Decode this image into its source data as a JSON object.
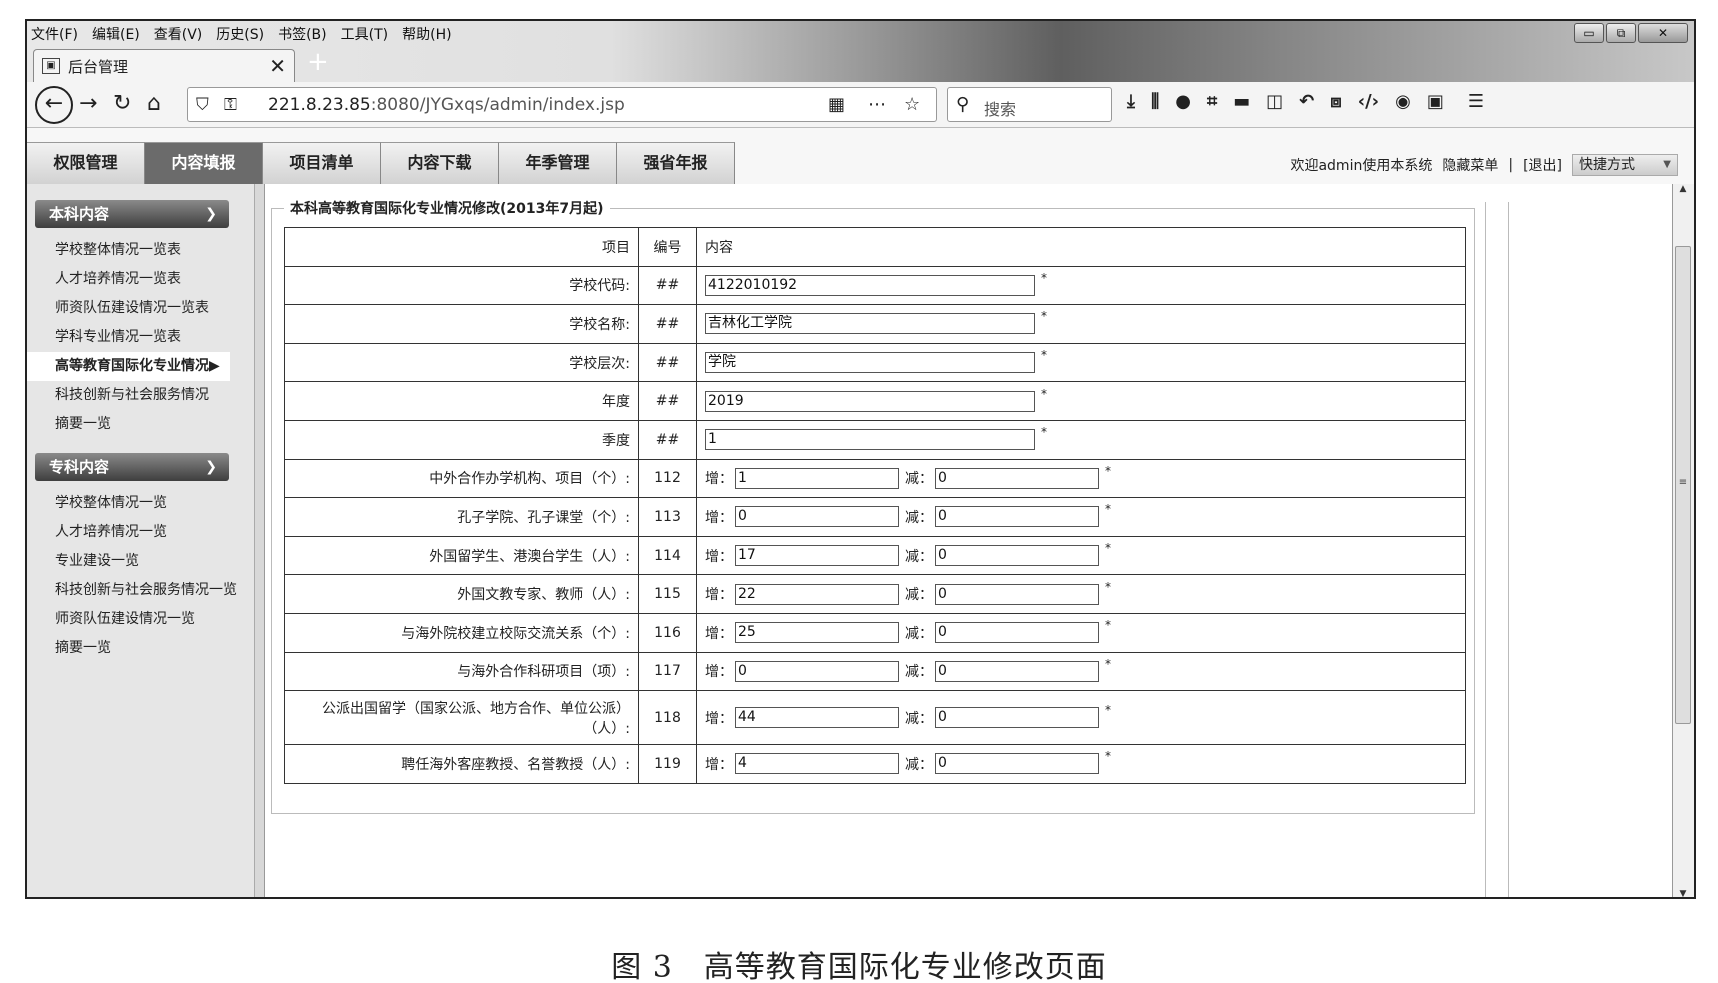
{
  "browser": {
    "menu": [
      "文件(F)",
      "编辑(E)",
      "查看(V)",
      "历史(S)",
      "书签(B)",
      "工具(T)",
      "帮助(H)"
    ],
    "tab_title": "后台管理",
    "tab_close": "✕",
    "new_tab": "+",
    "url_host": "221.8.23.85",
    "url_rest": ":8080/JYGxqs/admin/index.jsp",
    "search_placeholder": "搜索",
    "win_min": "▭",
    "win_max": "⧉",
    "win_close": "✕"
  },
  "app": {
    "tabs": [
      "权限管理",
      "内容填报",
      "项目清单",
      "内容下载",
      "年季管理",
      "强省年报"
    ],
    "active_tab": 1,
    "welcome": "欢迎admin使用本系统",
    "hide_menu": "隐藏菜单",
    "separator": "|",
    "logout": "[退出]",
    "quick": "快捷方式"
  },
  "sidebar": {
    "undergrad_title": "本科内容",
    "undergrad_items": [
      "学校整体情况一览表",
      "人才培养情况一览表",
      "师资队伍建设情况一览表",
      "学科专业情况一览表",
      "高等教育国际化专业情况▶",
      "科技创新与社会服务情况",
      "摘要一览"
    ],
    "vocational_title": "专科内容",
    "vocational_items": [
      "学校整体情况一览",
      "人才培养情况一览",
      "专业建设一览",
      "科技创新与社会服务情况一览",
      "师资队伍建设情况一览",
      "摘要一览"
    ]
  },
  "form": {
    "legend": "本科高等教育国际化专业情况修改(2013年7月起)",
    "headers": {
      "item": "项目",
      "no": "编号",
      "content": "内容"
    },
    "inc_label": "增：",
    "dec_label": "减：",
    "required": "*",
    "basic_rows": [
      {
        "label": "学校代码:",
        "no": "##",
        "value": "4122010192"
      },
      {
        "label": "学校名称:",
        "no": "##",
        "value": "吉林化工学院"
      },
      {
        "label": "学校层次:",
        "no": "##",
        "value": "学院"
      },
      {
        "label": "年度",
        "no": "##",
        "value": "2019"
      },
      {
        "label": "季度",
        "no": "##",
        "value": "1"
      }
    ],
    "delta_rows": [
      {
        "label": "中外合作办学机构、项目（个）:",
        "no": "112",
        "inc": "1",
        "dec": "0"
      },
      {
        "label": "孔子学院、孔子课堂（个）:",
        "no": "113",
        "inc": "0",
        "dec": "0"
      },
      {
        "label": "外国留学生、港澳台学生（人）:",
        "no": "114",
        "inc": "17",
        "dec": "0"
      },
      {
        "label": "外国文教专家、教师（人）:",
        "no": "115",
        "inc": "22",
        "dec": "0"
      },
      {
        "label": "与海外院校建立校际交流关系（个）:",
        "no": "116",
        "inc": "25",
        "dec": "0"
      },
      {
        "label": "与海外合作科研项目（项）:",
        "no": "117",
        "inc": "0",
        "dec": "0"
      },
      {
        "label_line1": "公派出国留学（国家公派、地方合作、单位公派）",
        "label_line2": "（人）:",
        "no": "118",
        "inc": "44",
        "dec": "0"
      },
      {
        "label": "聘任海外客座教授、名誉教授（人）:",
        "no": "119",
        "inc": "4",
        "dec": "0"
      }
    ]
  },
  "caption": "图 3　高等教育国际化专业修改页面"
}
